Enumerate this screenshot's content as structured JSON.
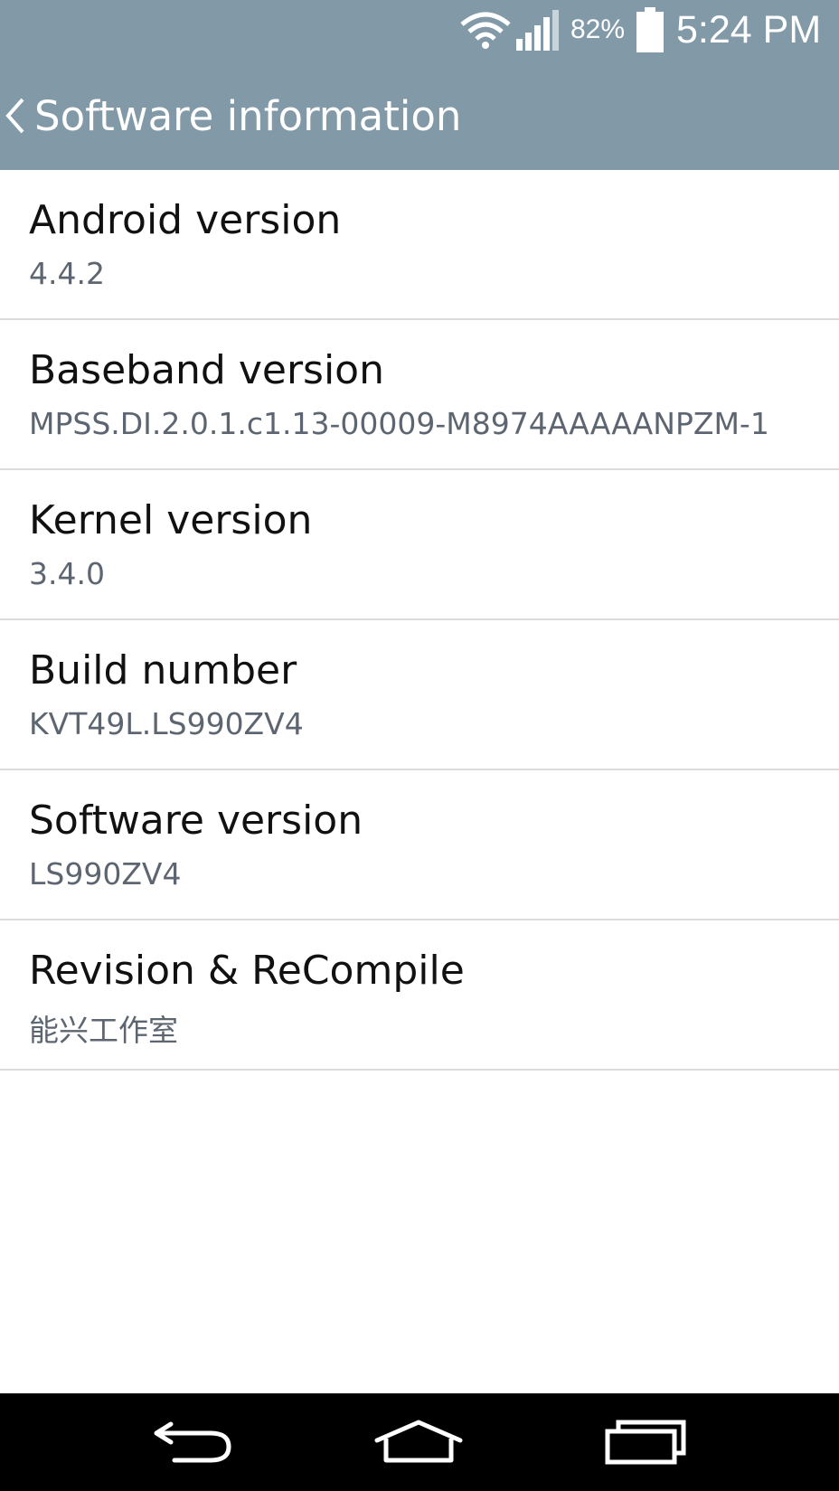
{
  "status_bar": {
    "wifi_icon": "wifi-icon",
    "signal_icon": "cell-signal-icon",
    "battery_percent": "82%",
    "battery_icon": "battery-icon",
    "time": "5:24 PM"
  },
  "header": {
    "back_icon": "chevron-left-icon",
    "title": "Software information",
    "color": "#8299a8"
  },
  "items": [
    {
      "label": "Android version",
      "value": "4.4.2"
    },
    {
      "label": "Baseband version",
      "value": "MPSS.DI.2.0.1.c1.13-00009-M8974AAAAANPZM-1"
    },
    {
      "label": "Kernel version",
      "value": "3.4.0"
    },
    {
      "label": "Build number",
      "value": "KVT49L.LS990ZV4"
    },
    {
      "label": "Software version",
      "value": "LS990ZV4"
    },
    {
      "label": "Revision & ReCompile",
      "value": "能兴工作室"
    }
  ],
  "nav_bar": {
    "back_icon": "nav-back-icon",
    "home_icon": "nav-home-icon",
    "recents_icon": "nav-recents-icon"
  }
}
